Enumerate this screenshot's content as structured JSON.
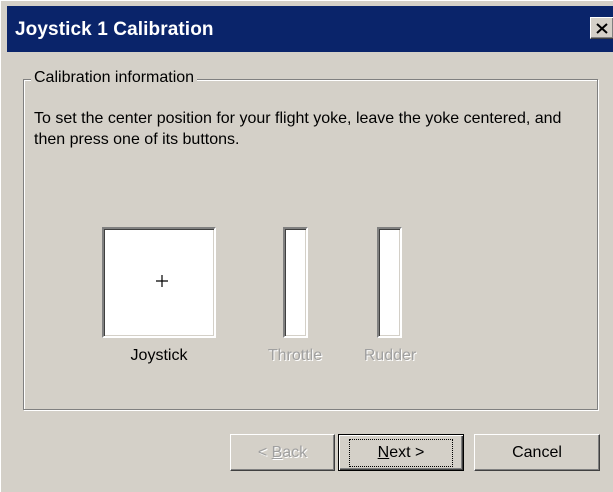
{
  "window": {
    "title": "Joystick 1 Calibration",
    "close_glyph": "✕",
    "close_icon": "close-icon"
  },
  "group": {
    "legend": "Calibration information",
    "instructions": "To set the center position for your flight yoke, leave the yoke centered, and then press one of its buttons."
  },
  "axes": {
    "joystick_label": "Joystick",
    "throttle_label": "Throttle",
    "rudder_label": "Rudder",
    "crosshair_icon": "crosshair-icon"
  },
  "buttons": {
    "back": {
      "mnemonic_prefix": "< ",
      "mnemonic": "B",
      "rest": "ack",
      "enabled": false
    },
    "next": {
      "mnemonic": "N",
      "rest": "ext >",
      "enabled": true
    },
    "cancel": {
      "label": "Cancel",
      "enabled": true
    }
  },
  "colors": {
    "titlebar": "#0a246a",
    "dialog_bg": "#d4d0c8",
    "disabled_text": "#a0a0a0"
  }
}
